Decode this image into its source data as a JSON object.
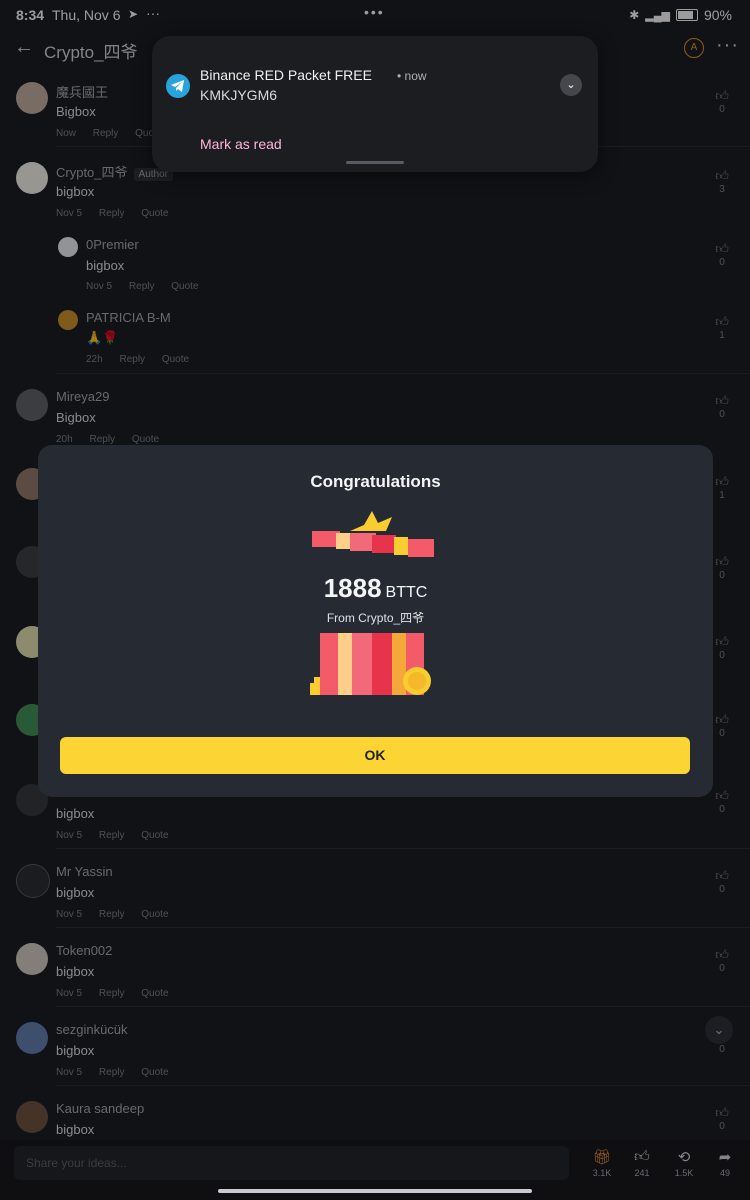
{
  "status_bar": {
    "time": "8:34",
    "date": "Thu, Nov 6",
    "battery": "90%"
  },
  "top_bar": {
    "title": "Crypto_四爷"
  },
  "notification": {
    "title": "Binance RED Packet FREE",
    "time": "now",
    "body": "KMKJYGM6",
    "mark_read": "Mark as read"
  },
  "modal": {
    "title": "Congratulations",
    "amount": "1888",
    "currency": "BTTC",
    "from": "From Crypto_四爷",
    "ok_label": "OK"
  },
  "comments": [
    {
      "name": "魔兵國王",
      "text": "Bigbox",
      "time": "Now",
      "likes": "0"
    },
    {
      "name": "Crypto_四爷",
      "author": "Author",
      "text": "bigbox",
      "time": "Nov 5",
      "likes": "3"
    },
    {
      "name": "0Premier",
      "text": "bigbox",
      "time": "Nov 5",
      "likes": "0",
      "reply": true
    },
    {
      "name": "PATRICIA B-M",
      "text": "🙏🌹",
      "time": "22h",
      "likes": "1",
      "reply": true
    },
    {
      "name": "Mireya29",
      "text": "Bigbox",
      "time": "20h",
      "likes": "0"
    },
    {
      "name": "",
      "text": "bigbox",
      "time": "Nov 5",
      "likes": "0"
    },
    {
      "name": "Mr Yassin",
      "text": "bigbox",
      "time": "Nov 5",
      "likes": "0"
    },
    {
      "name": "Token002",
      "text": "bigbox",
      "time": "Nov 5",
      "likes": "0"
    },
    {
      "name": "sezginkücük",
      "text": "bigbox",
      "time": "Nov 5",
      "likes": "0"
    },
    {
      "name": "Kaura sandeep",
      "text": "bigbox",
      "time": "",
      "likes": "0"
    }
  ],
  "hidden_likes": [
    "1",
    "0",
    "0",
    "0"
  ],
  "actions": {
    "reply": "Reply",
    "quote": "Quote"
  },
  "bottom_bar": {
    "placeholder": "Share your ideas...",
    "gift_count": "3.1K",
    "like_count": "241",
    "repost_count": "1.5K",
    "share_count": "49"
  },
  "icons": [
    "back-arrow-icon",
    "more-icon",
    "telegram-icon",
    "chevron-down-icon",
    "thumb-up-icon",
    "gift-icon",
    "repost-icon",
    "share-icon"
  ],
  "colors": {
    "accent": "#fcd535",
    "telegram": "#29a3dc",
    "mark_read": "#ffb6e0",
    "gift_red": "#ef4455"
  }
}
